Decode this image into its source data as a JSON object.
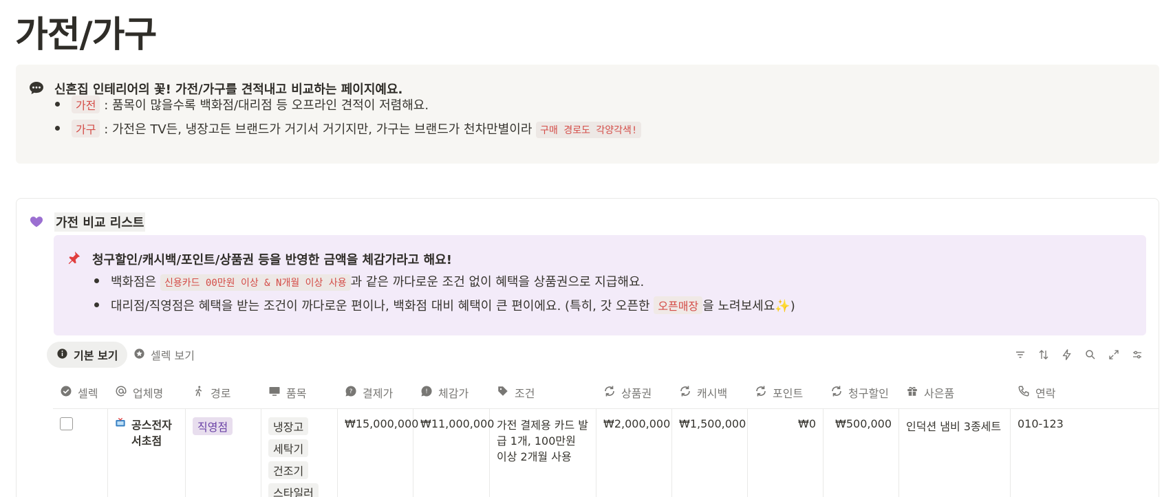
{
  "page": {
    "title": "가전/가구"
  },
  "callout": {
    "icon": "speech-bubble-icon",
    "heading": "신혼집 인테리어의 꽃! 가전/가구를 견적내고 비교하는 페이지예요.",
    "bullets": [
      {
        "tag": "가전",
        "text": ": 품목이 많을수록 백화점/대리점 등 오프라인 견적이 저렴해요."
      },
      {
        "tag": "가구",
        "text": ": 가전은 TV든, 냉장고든 브랜드가 거기서 거기지만, 가구는 브랜드가 천차만별이라",
        "code": "구매 경로도 각양각색!"
      }
    ]
  },
  "database": {
    "icon": "purple-heart-icon",
    "title": "가전 비교 리스트",
    "note": {
      "icon": "pushpin-icon",
      "heading": "청구할인/캐시백/포인트/상품권 등을 반영한 금액을 체감가라고 해요!",
      "bullet1": {
        "pre": "백화점은",
        "code": "신용카드 00만원 이상 & N개월 이상 사용",
        "post": "과 같은 까다로운 조건 없이 혜택을 상품권으로 지급해요."
      },
      "bullet2": {
        "pre": "대리점/직영점은 혜택을 받는 조건이 까다로운 편이나, 백화점 대비 혜택이 큰 편이에요. (특히, 갓 오픈한",
        "tag": "오픈매장",
        "post": "을 노려보세요✨)"
      }
    },
    "views": [
      {
        "label": "기본 보기",
        "icon": "info-icon",
        "active": true
      },
      {
        "label": "셀렉 보기",
        "icon": "star-circle-icon",
        "active": false
      }
    ],
    "columns": [
      "셀렉",
      "업체명",
      "경로",
      "품목",
      "결제가",
      "체감가",
      "조건",
      "상품권",
      "캐시백",
      "포인트",
      "청구할인",
      "사은품",
      "연락"
    ],
    "rows": [
      {
        "company_icon": "tv-icon",
        "company": "공스전자 서초점",
        "route": "직영점",
        "items": [
          "냉장고",
          "세탁기",
          "건조기",
          "스타일러"
        ],
        "price": "₩15,000,000",
        "felt_price": "₩11,000,000",
        "condition": "가전 결제용 카드 발급 1개, 100만원 이상 2개월 사용",
        "gift_card": "₩2,000,000",
        "cashback": "₩1,500,000",
        "points": "₩0",
        "billing_discount": "₩500,000",
        "freebie": "인덕션 냄비 3종세트",
        "contact": "010-123"
      }
    ]
  },
  "colors": {
    "callout_bg": "#f7f6f3",
    "note_bg": "#f3ebf9",
    "red_text": "#d44c47",
    "purple_tag": "#6940a5"
  }
}
